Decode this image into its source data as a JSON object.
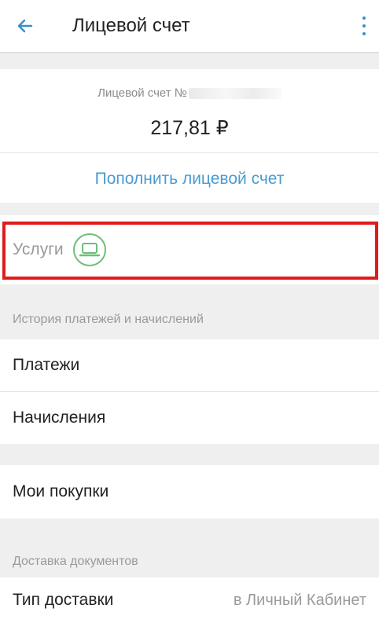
{
  "appbar": {
    "title": "Лицевой счет",
    "back_icon": "arrow-left-icon",
    "menu_icon": "more-vertical-icon"
  },
  "account": {
    "number_label": "Лицевой счет №",
    "balance": "217,81 ₽",
    "topup_label": "Пополнить лицевой счет"
  },
  "services": {
    "label": "Услуги",
    "icon": "laptop-icon",
    "icon_color": "#6dbf77",
    "highlight_color": "#e01b1b"
  },
  "history": {
    "header": "История платежей и начислений",
    "items": [
      {
        "label": "Платежи"
      },
      {
        "label": "Начисления"
      }
    ]
  },
  "purchases": {
    "label": "Мои покупки"
  },
  "delivery": {
    "header": "Доставка документов",
    "type_label": "Тип доставки",
    "type_value": "в Личный Кабинет"
  },
  "colors": {
    "accent": "#4a9cd1",
    "background": "#efefef"
  }
}
